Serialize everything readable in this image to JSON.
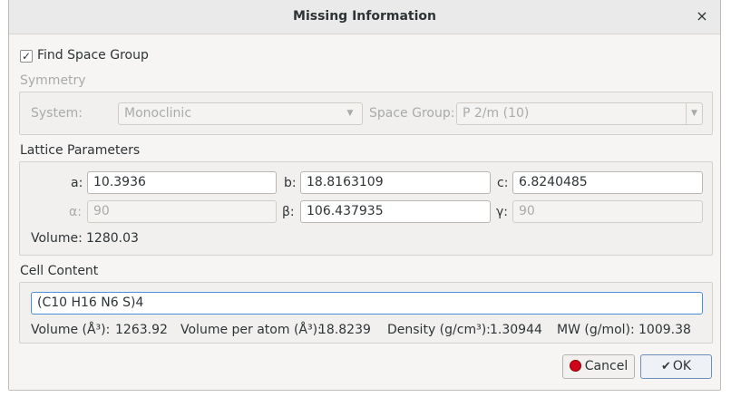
{
  "window": {
    "title": "Missing Information",
    "close_glyph": "×"
  },
  "find_space_group": {
    "label": "Find Space Group",
    "checked_glyph": "✓"
  },
  "symmetry": {
    "title": "Symmetry",
    "system_label": "System:",
    "system_value": "Monoclinic",
    "space_group_label": "Space Group:",
    "space_group_value": "P 2/m (10)"
  },
  "lattice": {
    "title": "Lattice Parameters",
    "a_label": "a:",
    "a_value": "10.3936",
    "b_label": "b:",
    "b_value": "18.8163109",
    "c_label": "c:",
    "c_value": "6.8240485",
    "alpha_label": "α:",
    "alpha_value": "90",
    "beta_label": "β:",
    "beta_value": "106.437935",
    "gamma_label": "γ:",
    "gamma_value": "90",
    "volume_label": "Volume:",
    "volume_value": "1280.03"
  },
  "cell_content": {
    "title": "Cell Content",
    "formula": "(C10 H16 N6 S)4",
    "volume_label": "Volume (Å³):",
    "volume_value": "1263.92",
    "vpa_label": "Volume per atom (Å³):",
    "vpa_value": "18.8239",
    "density_label": "Density (g/cm³):",
    "density_value": "1.30944",
    "mw_label": "MW (g/mol):",
    "mw_value": "1009.38"
  },
  "buttons": {
    "cancel": "Cancel",
    "ok": "OK"
  },
  "icons": {
    "cancel": "stop-icon",
    "ok": "check-hand-icon",
    "dropdown": "chevron-down-icon"
  }
}
